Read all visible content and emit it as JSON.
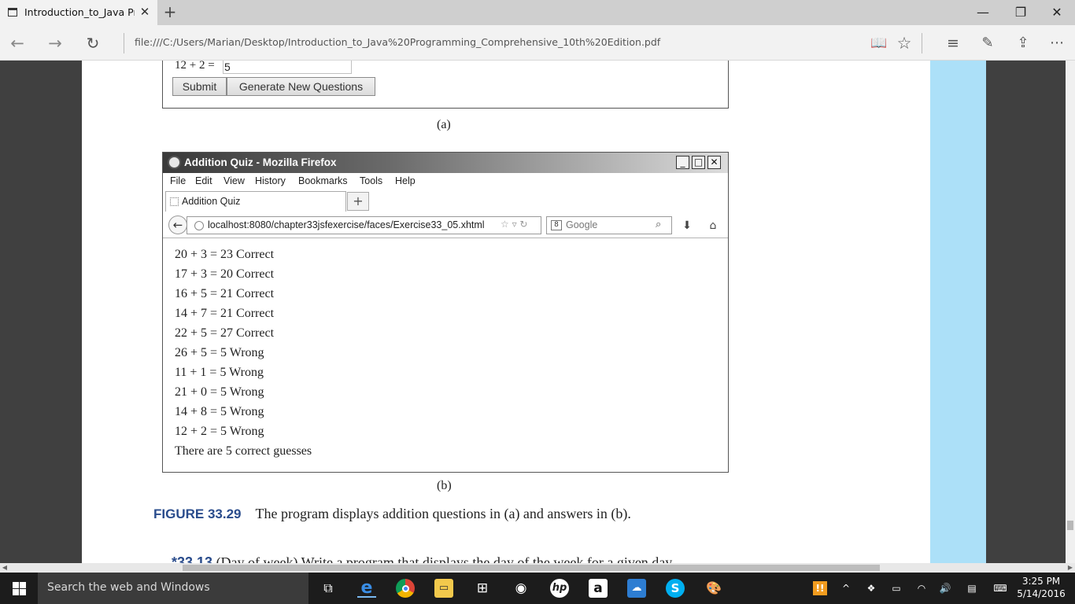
{
  "browser": {
    "tab_title": "Introduction_to_Java Prc",
    "tab_close_glyph": "✕",
    "new_tab_glyph": "+",
    "url": "file:///C:/Users/Marian/Desktop/Introduction_to_Java%20Programming_Comprehensive_10th%20Edition.pdf",
    "window_controls": {
      "minimize": "—",
      "restore": "❐",
      "close": "✕"
    },
    "icons": [
      "back-icon",
      "forward-icon",
      "refresh-icon",
      "reading-view-icon",
      "favorite-star-icon",
      "hub-icon",
      "web-note-icon",
      "share-icon",
      "more-icon"
    ]
  },
  "document": {
    "figure_a": {
      "question": "12 + 2 =",
      "answer_value": "5",
      "submit_label": "Submit",
      "generate_label": "Generate New Questions",
      "caption": "(a)"
    },
    "figure_b": {
      "window_title": "Addition Quiz - Mozilla Firefox",
      "menu": [
        "File",
        "Edit",
        "View",
        "History",
        "Bookmarks",
        "Tools",
        "Help"
      ],
      "tab_title": "Addition Quiz",
      "new_tab_glyph": "+",
      "url": "localhost:8080/chapter33jsfexercise/faces/Exercise33_05.xhtml",
      "search_placeholder": "Google",
      "results": [
        "20 + 3 = 23 Correct",
        "17 + 3 = 20 Correct",
        "16 + 5 = 21 Correct",
        "14 + 7 = 21 Correct",
        "22 + 5 = 27 Correct",
        "26 + 5 = 5 Wrong",
        "11 + 1 = 5 Wrong",
        "21 + 0 = 5 Wrong",
        "14 + 8 = 5 Wrong",
        "12 + 2 = 5 Wrong",
        "There are 5 correct guesses"
      ],
      "caption": "(b)"
    },
    "figure_caption": {
      "label": "FIGURE 33.29",
      "text": "The program displays addition questions in (a) and answers in (b)."
    },
    "cut_off_line": {
      "number": "*33.13",
      "text": "(Day of week) Write a program that displays the day of the week for a given day"
    },
    "colors": {
      "page_bg": "#ffffff",
      "side_bg": "#404040",
      "cyan_band": "#ace0f8",
      "caption_label": "#2a4c8c"
    }
  },
  "taskbar": {
    "search_placeholder": "Search the web and Windows",
    "apps": [
      "task-view-icon",
      "edge-icon",
      "chrome-icon",
      "file-explorer-icon",
      "store-icon",
      "app-circle-icon",
      "hp-icon",
      "amazon-icon",
      "photos-icon",
      "skype-icon",
      "paint-icon"
    ],
    "time": "3:25 PM",
    "date": "5/14/2016"
  }
}
